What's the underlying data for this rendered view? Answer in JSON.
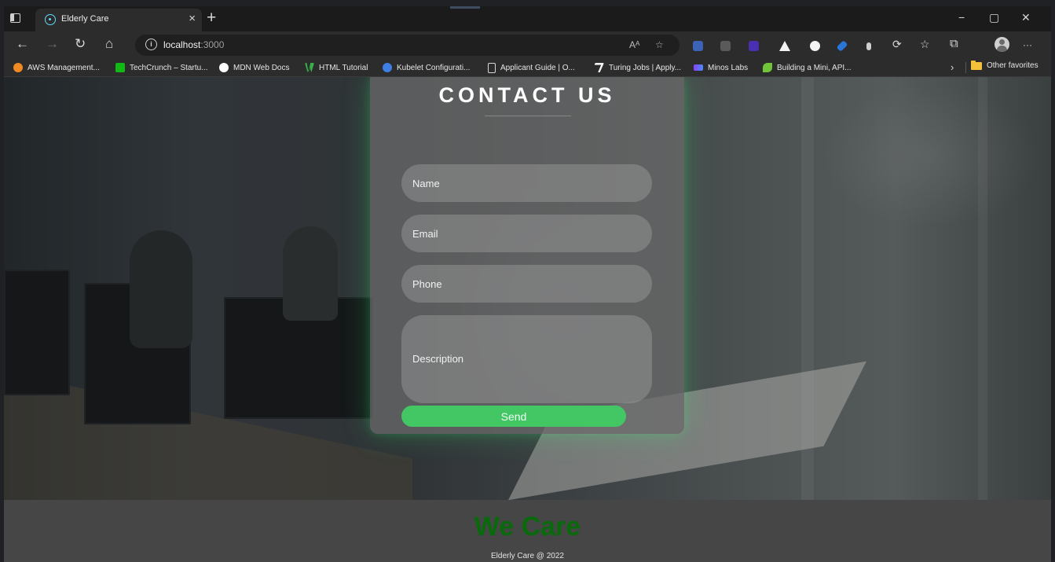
{
  "browser": {
    "tab_title": "Elderly Care",
    "url_host": "localhost",
    "url_port": ":3000",
    "read_aloud_label": "Aᴬ",
    "more_label": "···"
  },
  "bookmarks": [
    {
      "label": "AWS Management...",
      "icon": "aws-icon",
      "color": "#f08a22"
    },
    {
      "label": "TechCrunch – Startu...",
      "icon": "techcrunch-icon",
      "color": "#12b814"
    },
    {
      "label": "MDN Web Docs",
      "icon": "mdn-icon",
      "color": "#ffffff"
    },
    {
      "label": "HTML Tutorial",
      "icon": "w3schools-icon",
      "color": "#35b04a"
    },
    {
      "label": "Kubelet Configurati...",
      "icon": "kubernetes-icon",
      "color": "#3f7fe4"
    },
    {
      "label": "Applicant Guide | O...",
      "icon": "document-icon",
      "color": "#d8d8d8"
    },
    {
      "label": "Turing Jobs | Apply...",
      "icon": "turing-icon",
      "color": "#f4f4f4"
    },
    {
      "label": "Minos Labs",
      "icon": "minos-labs-icon",
      "color": "#4b8cff"
    },
    {
      "label": "Building a Mini, API...",
      "icon": "leaf-icon",
      "color": "#71c33a"
    }
  ],
  "other_favorites": "Other favorites",
  "contact": {
    "title": "CONTACT US",
    "name_placeholder": "Name",
    "email_placeholder": "Email",
    "phone_placeholder": "Phone",
    "description_placeholder": "Description",
    "send_label": "Send"
  },
  "footer": {
    "brand": "We Care",
    "copyright": "Elderly Care @ 2022"
  },
  "colors": {
    "send_button": "#42c764",
    "footer_brand": "#096a0c",
    "card_glow": "#38ff79"
  }
}
